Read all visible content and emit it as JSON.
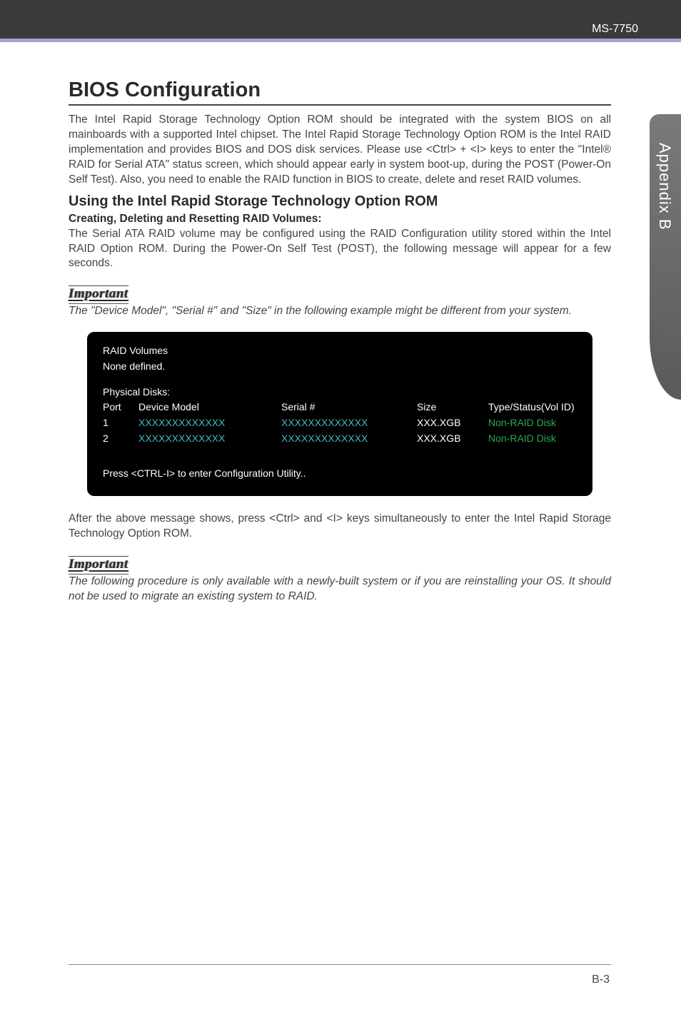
{
  "header": {
    "model": "MS-7750"
  },
  "sidetab": "Appendix B",
  "title": "BIOS Configuration",
  "intro": "The Intel Rapid Storage Technology Option ROM should be integrated with the system BIOS on all mainboards with a supported Intel chipset. The Intel Rapid Storage Technology Option ROM is the Intel RAID implementation and provides BIOS and DOS disk services. Please use <Ctrl> + <I> keys to enter the \"Intel® RAID for Serial ATA\" status screen, which should  appear early in system boot-up, during the POST (Power-On Self Test). Also, you need to enable the RAID function in BIOS to create, delete and reset RAID volumes.",
  "subtitle": "Using the Intel Rapid Storage Technology Option ROM",
  "subhead": "Creating, Deleting and Resetting RAID Volumes:",
  "para2": "The Serial ATA RAID volume may be configured using the RAID Configuration utility stored within the Intel RAID Option ROM. During the Power-On Self Test (POST), the following message will appear for a few seconds.",
  "important_label": "Important",
  "note1": "The \"Device Model\", \"Serial #\" and \"Size\" in the following example might be different from your system.",
  "chart_data": {
    "type": "table",
    "title_lines": [
      "RAID Volumes",
      "None defined."
    ],
    "section_label": "Physical Disks:",
    "columns": [
      "Port",
      "Device Model",
      "Serial #",
      "Size",
      "Type/Status(Vol ID)"
    ],
    "rows": [
      {
        "port": "1",
        "model": "XXXXXXXXXXXXX",
        "serial": "XXXXXXXXXXXXX",
        "size": "XXX.XGB",
        "status": "Non-RAID Disk"
      },
      {
        "port": "2",
        "model": "XXXXXXXXXXXXX",
        "serial": "XXXXXXXXXXXXX",
        "size": "XXX.XGB",
        "status": "Non-RAID Disk"
      }
    ],
    "footer": "Press  <CTRL-I>  to enter Configuration Utility.."
  },
  "para3": "After the above message shows, press <Ctrl> and <I> keys simultaneously to enter the Intel Rapid Storage Technology Option ROM.",
  "note2": "The following procedure is only available with a newly-built system or if you are reinstalling your OS. It should not be used to migrate an existing system to RAID.",
  "page_number": "B-3"
}
